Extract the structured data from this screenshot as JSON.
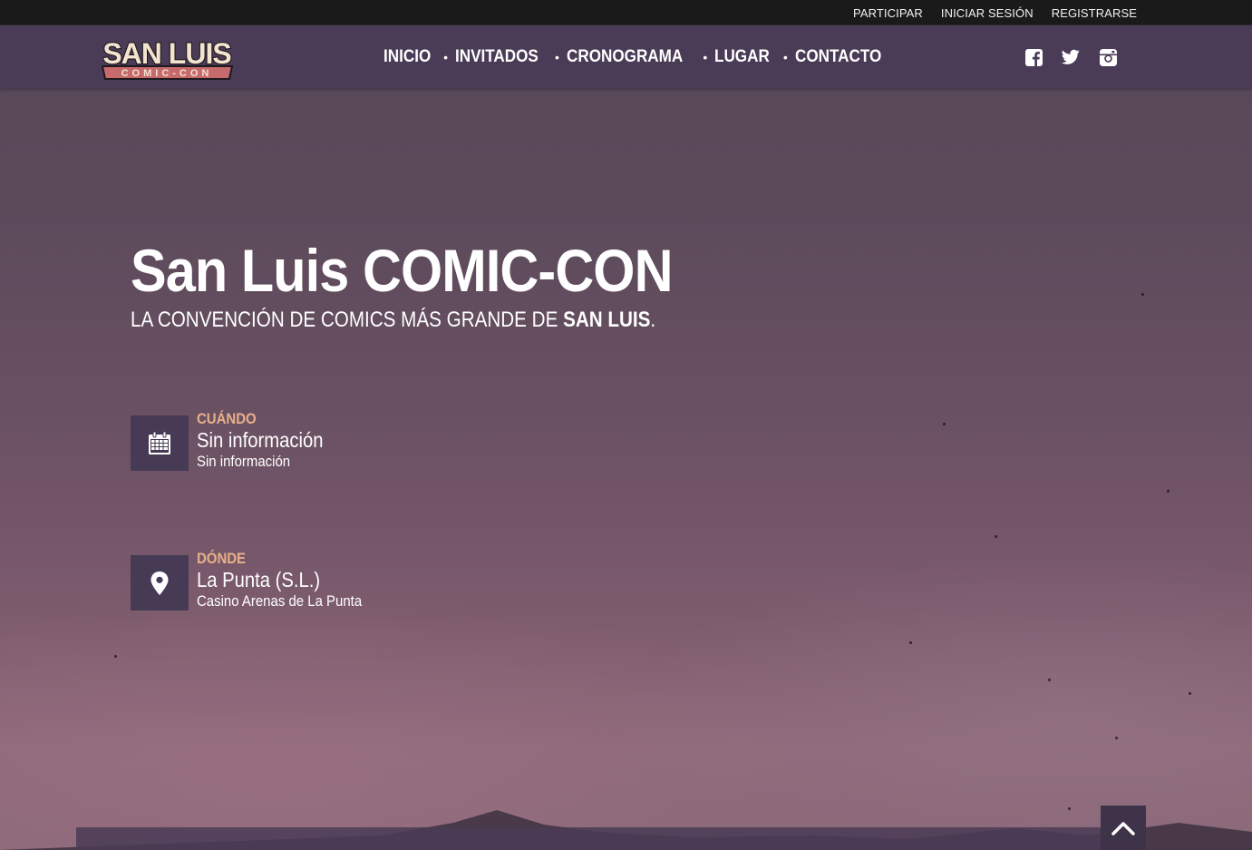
{
  "topbar": {
    "links": [
      "PARTICIPAR",
      "INICIAR SESIÓN",
      "REGISTRARSE"
    ]
  },
  "brand": {
    "logo_top": "SAN LUIS",
    "logo_bottom": "COMIC-CON",
    "colors": {
      "nav_bg": "#4a3b56",
      "accent": "#e7b08a",
      "topbar_bg": "#1a1a1a"
    }
  },
  "nav": {
    "items": [
      "INICIO",
      "INVITADOS",
      "CRONOGRAMA",
      "LUGAR",
      "CONTACTO"
    ],
    "separator": "•"
  },
  "social": {
    "icons": [
      "facebook-icon",
      "twitter-icon",
      "instagram-icon"
    ]
  },
  "hero": {
    "title": "San Luis COMIC-CON",
    "subtitle_prefix": "LA CONVENCIÓN DE COMICS MÁS GRANDE DE ",
    "subtitle_bold": "SAN LUIS",
    "subtitle_suffix": "."
  },
  "when": {
    "icon": "calendar-icon",
    "label": "CUÁNDO",
    "main": "Sin información",
    "sub": "Sin información"
  },
  "where": {
    "icon": "map-pin-icon",
    "label": "DÓNDE",
    "main": "La Punta (S.L.)",
    "sub": "Casino Arenas de La Punta"
  },
  "back_to_top": {
    "icon": "chevron-up-icon"
  }
}
